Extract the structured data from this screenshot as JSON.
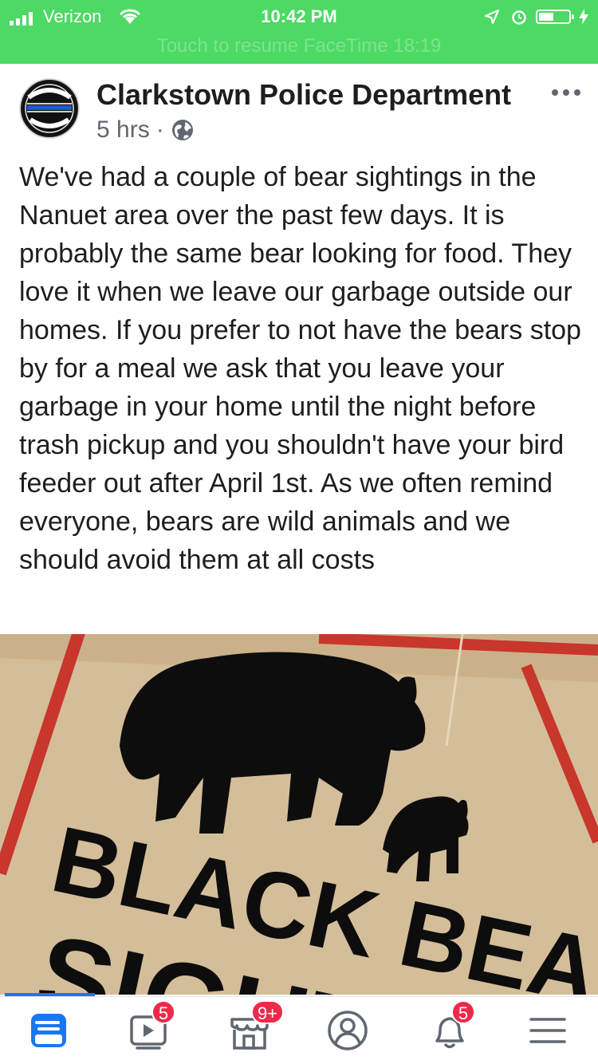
{
  "status_bar": {
    "carrier": "Verizon",
    "time": "10:42 PM",
    "banner": "Touch to resume FaceTime 18:19",
    "colors": {
      "background": "#4cd964"
    }
  },
  "post": {
    "page_name": "Clarkstown Police Department",
    "age": "5 hrs",
    "separator": "·",
    "audience_icon": "globe-icon",
    "more_icon": "more-horizontal-icon",
    "avatar_text": {
      "top": "CLARKSTOWN",
      "bottom": "POLICE",
      "state": "N.Y."
    },
    "body": "We've had a couple of bear sightings in the Nanuet area over the past few days. It is probably the same bear looking for food. They love it when we leave our garbage outside our homes. If you prefer to not have the bears stop by for a meal we ask that you leave your garbage in your home until the night before trash pickup and you shouldn't have your bird feeder out after April 1st. As we often remind everyone, bears are wild animals and we should avoid them at all costs",
    "photo": {
      "sign_line1": "BLACK BEAR",
      "sign_line2": "SIGHTI"
    }
  },
  "tab_bar": {
    "tabs": [
      {
        "icon": "news-feed-icon",
        "badge": "",
        "active": true
      },
      {
        "icon": "watch-video-icon",
        "badge": "5"
      },
      {
        "icon": "marketplace-icon",
        "badge": "9+"
      },
      {
        "icon": "profile-icon",
        "badge": ""
      },
      {
        "icon": "notifications-bell-icon",
        "badge": "5"
      },
      {
        "icon": "menu-icon",
        "badge": ""
      }
    ],
    "colors": {
      "active": "#1877f2",
      "inactive": "#606770",
      "badge": "#f02849"
    }
  }
}
